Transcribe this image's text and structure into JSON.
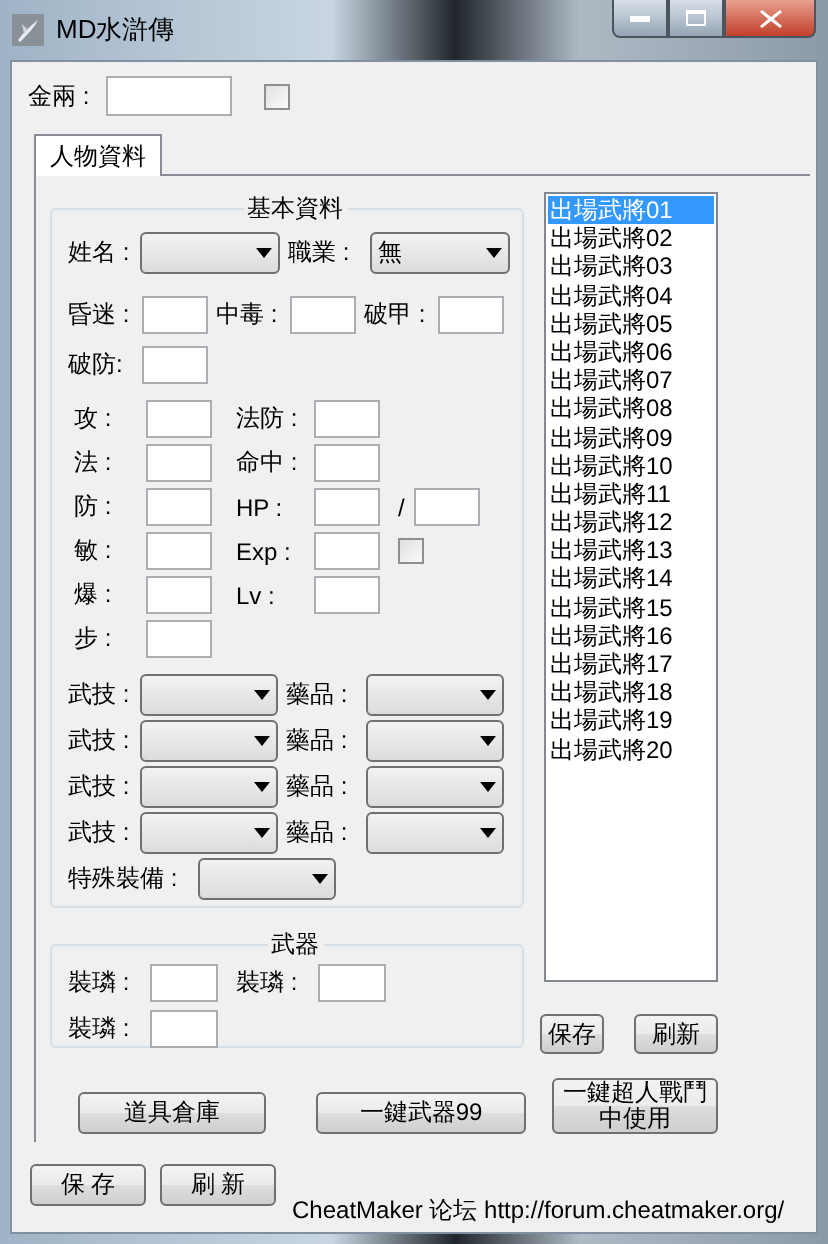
{
  "window": {
    "title": "MD水滸傳"
  },
  "gold": {
    "label": "金兩 :",
    "checked": false
  },
  "tabs": [
    {
      "label": "人物資料",
      "selected": true
    }
  ],
  "basic_info": {
    "title": "基本資料",
    "selects": [
      {
        "label": "姓名 :"
      },
      {
        "label": "職業 :",
        "value": "無"
      }
    ],
    "status_fields": [
      {
        "label": "昏迷 :"
      },
      {
        "label": "中毒 :"
      },
      {
        "label": "破甲 :"
      },
      {
        "label": "破防:"
      }
    ],
    "stats_left": [
      {
        "label": "攻 :"
      },
      {
        "label": "法 :"
      },
      {
        "label": "防 :"
      },
      {
        "label": "敏 :"
      },
      {
        "label": "爆 :"
      },
      {
        "label": "步 :"
      }
    ],
    "stats_right": [
      {
        "label": "法防 :",
        "kind": "plain"
      },
      {
        "label": "命中 :",
        "kind": "plain"
      },
      {
        "label": "HP :",
        "kind": "pair",
        "separator": "/"
      },
      {
        "label": "Exp :",
        "kind": "check",
        "checked": false
      },
      {
        "label": "Lv :",
        "kind": "plain"
      }
    ],
    "skill_rows": [
      {
        "skill_label": "武技 :",
        "item_label": "藥品 :"
      },
      {
        "skill_label": "武技 :",
        "item_label": "藥品 :"
      },
      {
        "skill_label": "武技 :",
        "item_label": "藥品 :"
      },
      {
        "skill_label": "武技 :",
        "item_label": "藥品 :"
      }
    ],
    "special": {
      "label": "特殊裝備 :"
    }
  },
  "weapon": {
    "title": "武器",
    "slots": [
      {
        "label": "裝璘 :"
      },
      {
        "label": "裝璘 :"
      },
      {
        "label": "裝璘 :"
      }
    ]
  },
  "generals": [
    {
      "label": "出場武將01",
      "selected": true
    },
    {
      "label": "出場武將02",
      "selected": false
    },
    {
      "label": "出場武將03",
      "selected": false
    },
    {
      "label": "出場武將04",
      "selected": false
    },
    {
      "label": "出場武將05",
      "selected": false
    },
    {
      "label": "出場武將06",
      "selected": false
    },
    {
      "label": "出場武將07",
      "selected": false
    },
    {
      "label": "出場武將08",
      "selected": false
    },
    {
      "label": "出場武將09",
      "selected": false
    },
    {
      "label": "出場武將10",
      "selected": false
    },
    {
      "label": "出場武將11",
      "selected": false
    },
    {
      "label": "出場武將12",
      "selected": false
    },
    {
      "label": "出場武將13",
      "selected": false
    },
    {
      "label": "出場武將14",
      "selected": false
    },
    {
      "label": "出場武將15",
      "selected": false
    },
    {
      "label": "出場武將16",
      "selected": false
    },
    {
      "label": "出場武將17",
      "selected": false
    },
    {
      "label": "出場武將18",
      "selected": false
    },
    {
      "label": "出場武將19",
      "selected": false
    },
    {
      "label": "出場武將20",
      "selected": false
    }
  ],
  "list_buttons": [
    "保存",
    "刷新"
  ],
  "action_buttons": [
    "道具倉庫",
    "一鍵武器99",
    "一鍵超人戰鬥中使用"
  ],
  "bottom_buttons": [
    "保 存",
    "刷 新"
  ],
  "footer": "CheatMaker 论坛 http://forum.cheatmaker.org/"
}
